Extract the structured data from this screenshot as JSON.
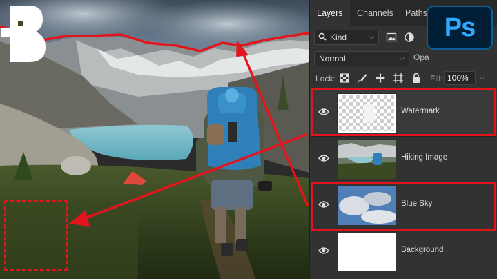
{
  "panel": {
    "tabs": [
      {
        "label": "Layers",
        "active": true
      },
      {
        "label": "Channels",
        "active": false
      },
      {
        "label": "Paths",
        "active": false
      }
    ],
    "filter": {
      "kind_label": "Kind",
      "icons": [
        "image-filter-icon",
        "adjustment-filter-icon",
        "type-filter-icon"
      ]
    },
    "blend_mode": "Normal",
    "opacity_label": "Opa",
    "lock_label": "Lock:",
    "lock_icons": [
      "lock-transparent-icon",
      "lock-image-icon",
      "lock-position-icon",
      "lock-artboard-icon",
      "lock-all-icon"
    ],
    "fill_label": "Fill:",
    "fill_value": "100%",
    "layers": [
      {
        "name": "Watermark",
        "visible": true,
        "highlighted": true
      },
      {
        "name": "Hiking Image",
        "visible": true,
        "highlighted": false
      },
      {
        "name": "Blue Sky",
        "visible": true,
        "highlighted": true
      },
      {
        "name": "Background",
        "visible": true,
        "highlighted": false
      }
    ]
  },
  "app_logo": {
    "text": "Ps",
    "bg": "#001e36",
    "fg": "#31a8ff"
  },
  "canvas": {
    "watermark_letter": "B",
    "highlight_color": "#e3141b"
  }
}
